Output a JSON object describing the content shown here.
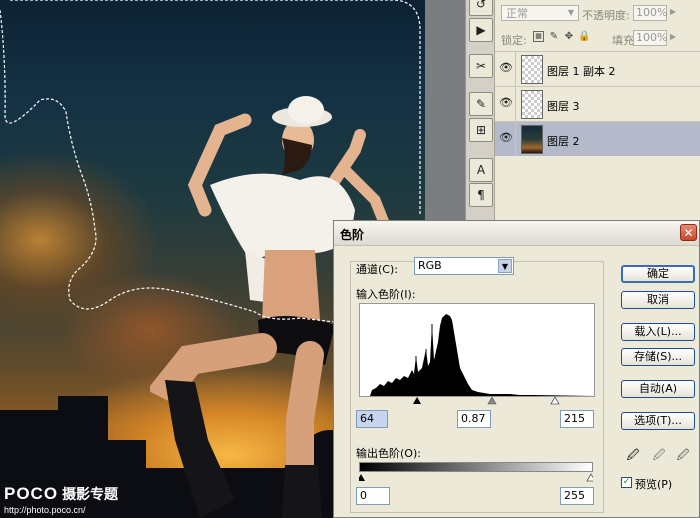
{
  "watermark": {
    "logo": "POCO",
    "subtitle": "摄影专题",
    "url": "http://photo.poco.cn/"
  },
  "layers_panel": {
    "blend_mode": "正常",
    "opacity_label": "不透明度:",
    "opacity_value": "100%",
    "lock_label": "锁定:",
    "fill_label": "填充:",
    "fill_value": "100%",
    "layers": [
      {
        "name": "图层 1 副本 2",
        "visible": true,
        "selected": false
      },
      {
        "name": "图层 3",
        "visible": true,
        "selected": false
      },
      {
        "name": "图层 2",
        "visible": true,
        "selected": true
      }
    ]
  },
  "levels_dialog": {
    "title": "色阶",
    "channel_label": "通道(C):",
    "channel_value": "RGB",
    "input_levels_label": "输入色阶(I):",
    "input_black": "64",
    "input_gamma": "0.87",
    "input_white": "215",
    "output_levels_label": "输出色阶(O):",
    "output_black": "0",
    "output_white": "255",
    "buttons": {
      "ok": "确定",
      "cancel": "取消",
      "load": "载入(L)...",
      "save": "存储(S)...",
      "auto": "自动(A)",
      "options": "选项(T)..."
    },
    "preview_label": "预览(P)",
    "preview_checked": true
  }
}
